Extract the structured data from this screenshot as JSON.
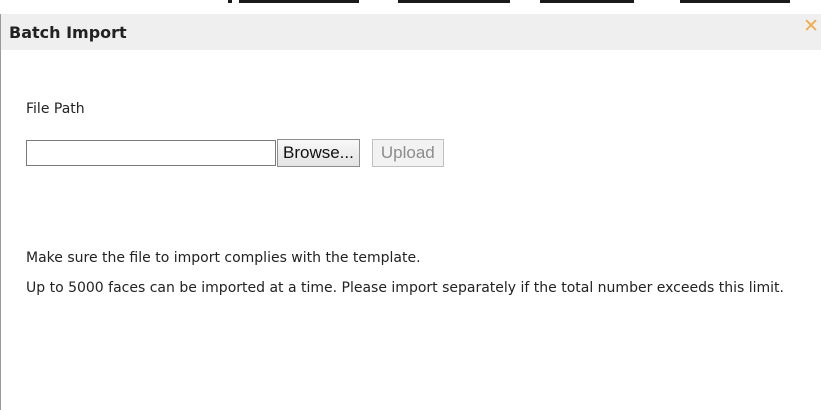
{
  "dialog": {
    "title": "Batch Import",
    "close_icon": "close-icon",
    "close_symbol": "✕"
  },
  "file": {
    "label": "File Path",
    "value": "",
    "placeholder": ""
  },
  "buttons": {
    "browse": "Browse...",
    "upload": "Upload"
  },
  "notes": {
    "line1": "Make sure the file to import complies with the template.",
    "line2": "Up to 5000 faces can be imported at a time. Please import separately if the total number exceeds this limit."
  },
  "colors": {
    "titlebar": "#efefef",
    "close_icon": "#f0ad4e",
    "text": "#222222",
    "upload_disabled_text": "#8c8c8c"
  }
}
